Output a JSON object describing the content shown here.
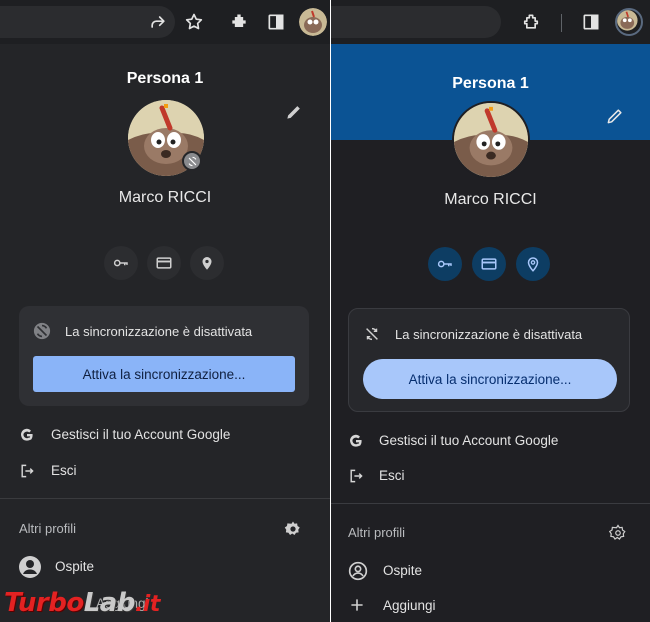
{
  "left": {
    "profile_title": "Persona 1",
    "user_name": "Marco RICCI",
    "sync_status": "La sincronizzazione è disattivata",
    "sync_button": "Attiva la sincronizzazione...",
    "menu": [
      {
        "icon": "google-g-icon",
        "label": "Gestisci il tuo Account Google"
      },
      {
        "icon": "sign-out-icon",
        "label": "Esci"
      }
    ],
    "other_profiles_title": "Altri profili",
    "guest_label": "Ospite",
    "add_label": "Aggiungi"
  },
  "right": {
    "profile_title": "Persona 1",
    "user_name": "Marco RICCI",
    "sync_status": "La sincronizzazione è disattivata",
    "sync_button": "Attiva la sincronizzazione...",
    "menu": [
      {
        "icon": "google-g-icon",
        "label": "Gestisci il tuo Account Google"
      },
      {
        "icon": "sign-out-icon",
        "label": "Esci"
      }
    ],
    "other_profiles_title": "Altri profili",
    "guest_label": "Ospite",
    "add_label": "Aggiungi"
  },
  "watermark": {
    "part1": "Turbo",
    "part2": "Lab",
    "part3": ".it"
  },
  "colors": {
    "left_bg": "#242528",
    "right_bg": "#1f1f23",
    "right_header": "#0b5394",
    "right_accent_btn": "#a8c7fa",
    "left_sync_btn": "#8ab4f8",
    "quick_action_right": "#0d3d63"
  }
}
